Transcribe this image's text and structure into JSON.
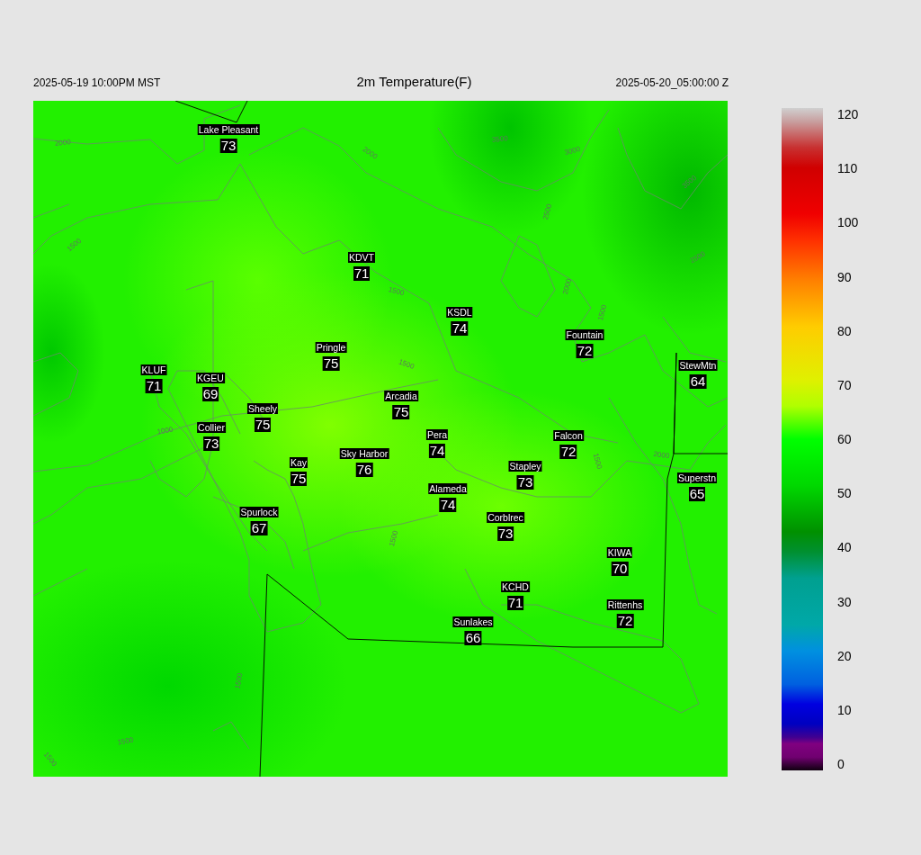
{
  "header": {
    "local_time": "2025-05-19 10:00PM MST",
    "title": "2m Temperature(F)",
    "valid_time": "2025-05-20_05:00:00 Z"
  },
  "stations": [
    {
      "name": "Lake Pleasant",
      "value": "73"
    },
    {
      "name": "KDVT",
      "value": "71"
    },
    {
      "name": "KSDL",
      "value": "74"
    },
    {
      "name": "Pringle",
      "value": "75"
    },
    {
      "name": "Fountain",
      "value": "72"
    },
    {
      "name": "KLUF",
      "value": "71"
    },
    {
      "name": "KGEU",
      "value": "69"
    },
    {
      "name": "StewMtn",
      "value": "64"
    },
    {
      "name": "Arcadia",
      "value": "75"
    },
    {
      "name": "Sheely",
      "value": "75"
    },
    {
      "name": "Collier",
      "value": "73"
    },
    {
      "name": "Pera",
      "value": "74"
    },
    {
      "name": "Falcon",
      "value": "72"
    },
    {
      "name": "Kay",
      "value": "75"
    },
    {
      "name": "Sky Harbor",
      "value": "76"
    },
    {
      "name": "Stapley",
      "value": "73"
    },
    {
      "name": "Alameda",
      "value": "74"
    },
    {
      "name": "Superstn",
      "value": "65"
    },
    {
      "name": "Spurlock",
      "value": "67"
    },
    {
      "name": "Corblrec",
      "value": "73"
    },
    {
      "name": "KIWA",
      "value": "70"
    },
    {
      "name": "KCHD",
      "value": "71"
    },
    {
      "name": "Rittenhs",
      "value": "72"
    },
    {
      "name": "Sunlakes",
      "value": "66"
    }
  ],
  "contour_labels": [
    "2000",
    "2000",
    "3500",
    "3000",
    "3500",
    "2500",
    "1500",
    "2500",
    "2000",
    "1500",
    "1500",
    "1500",
    "1000",
    "1500",
    "2000",
    "1500",
    "1500",
    "1500",
    "1500"
  ],
  "colorbar": {
    "ticks": [
      "120",
      "110",
      "100",
      "90",
      "80",
      "70",
      "60",
      "50",
      "40",
      "30",
      "20",
      "10",
      "0"
    ]
  }
}
